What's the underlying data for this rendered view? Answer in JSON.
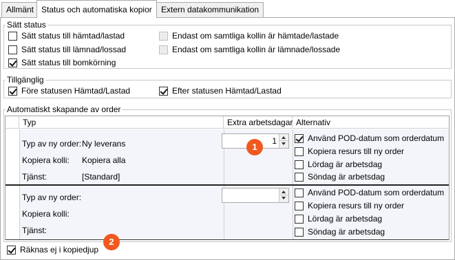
{
  "tabs": [
    {
      "label": "Allmänt"
    },
    {
      "label": "Status och automatiska kopior"
    },
    {
      "label": "Extern datakommunikation"
    }
  ],
  "status_group": {
    "title": "Sätt status",
    "options": [
      {
        "label": "Sätt status till hämtad/lastad",
        "checked": false
      },
      {
        "label": "Sätt status till lämnad/lossad",
        "checked": false
      },
      {
        "label": "Sätt status till bomkörning",
        "checked": true
      }
    ],
    "disabled_options": [
      {
        "label": "Endast om samtliga kollin är hämtade/lastade",
        "checked": false
      },
      {
        "label": "Endast om samtliga kollin är lämnade/lossade",
        "checked": false
      }
    ]
  },
  "availability_group": {
    "title": "Tillgänglig",
    "options": [
      {
        "label": "Före statusen Hämtad/Lastad",
        "checked": true
      },
      {
        "label": "Efter statusen Hämtad/Lastad",
        "checked": true
      }
    ]
  },
  "orders_group": {
    "title": "Automatiskt skapande av order",
    "columns": {
      "type": "Typ",
      "extra_days": "Extra arbetsdagar",
      "alternatives": "Alternativ"
    },
    "rows": [
      {
        "order_type_label": "Typ av ny order:",
        "order_type_value": "Ny leverans",
        "copy_items_label": "Kopiera kolli:",
        "copy_items_value": "Kopiera alla",
        "service_label": "Tjänst:",
        "service_value": "[Standard]",
        "extra_days": "1",
        "alternatives": [
          {
            "label": "Använd POD-datum som orderdatum",
            "checked": true
          },
          {
            "label": "Kopiera resurs till ny order",
            "checked": false
          },
          {
            "label": "Lördag är arbetsdag",
            "checked": false
          },
          {
            "label": "Söndag är arbetsdag",
            "checked": false
          }
        ]
      },
      {
        "order_type_label": "Typ av ny order:",
        "order_type_value": "",
        "copy_items_label": "Kopiera kolli:",
        "copy_items_value": "",
        "service_label": "Tjänst:",
        "service_value": "",
        "extra_days": "",
        "alternatives": [
          {
            "label": "Använd POD-datum som orderdatum",
            "checked": false
          },
          {
            "label": "Kopiera resurs till ny order",
            "checked": false
          },
          {
            "label": "Lördag är arbetsdag",
            "checked": false
          },
          {
            "label": "Söndag är arbetsdag",
            "checked": false
          }
        ]
      }
    ]
  },
  "exclude_copy_depth": {
    "label": "Räknas ej i kopiedjup",
    "checked": true
  },
  "badges": [
    "1",
    "2"
  ],
  "colors": {
    "badge": "#f0591f",
    "row_background": "#f3f5fa"
  }
}
